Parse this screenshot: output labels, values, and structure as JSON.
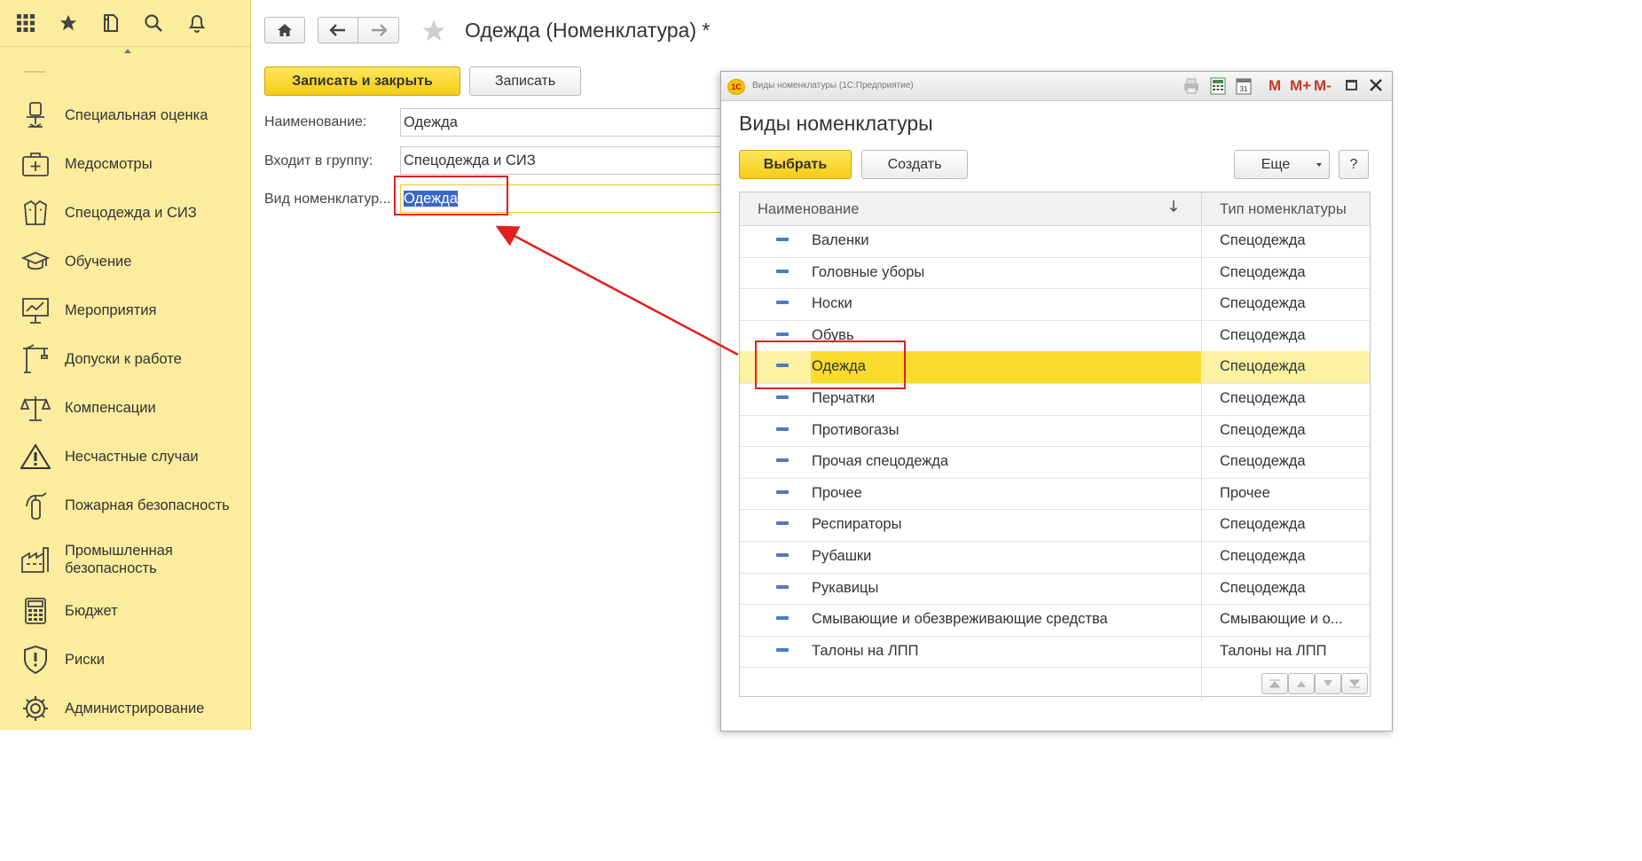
{
  "sidebar": {
    "items": [
      {
        "label": "Специальная оценка",
        "icon": "workplace-assessment-icon"
      },
      {
        "label": "Медосмотры",
        "icon": "medical-kit-icon"
      },
      {
        "label": "Спецодежда и СИЗ",
        "icon": "workwear-jacket-icon"
      },
      {
        "label": "Обучение",
        "icon": "graduation-cap-icon"
      },
      {
        "label": "Мероприятия",
        "icon": "presentation-board-icon"
      },
      {
        "label": "Допуски к работе",
        "icon": "crane-icon"
      },
      {
        "label": "Компенсации",
        "icon": "scales-icon"
      },
      {
        "label": "Несчастные случаи",
        "icon": "warning-triangle-icon"
      },
      {
        "label": "Пожарная безопасность",
        "icon": "fire-extinguisher-icon"
      },
      {
        "label": "Промышленная безопасность",
        "icon": "factory-icon"
      },
      {
        "label": "Бюджет",
        "icon": "calculator-icon"
      },
      {
        "label": "Риски",
        "icon": "risk-shield-icon"
      },
      {
        "label": "Администрирование",
        "icon": "gear-icon"
      }
    ]
  },
  "form": {
    "title": "Одежда (Номенклатура) *",
    "save_close_label": "Записать и закрыть",
    "save_label": "Записать",
    "name_label": "Наименование:",
    "name_value": "Одежда",
    "group_label": "Входит в группу:",
    "group_value": "Спецодежда и СИЗ",
    "kind_label": "Вид номенклатур...",
    "kind_value": "Одежда"
  },
  "dialog": {
    "window_title": "Виды номенклатуры  (1С:Предприятие)",
    "heading": "Виды номенклатуры",
    "select_label": "Выбрать",
    "create_label": "Создать",
    "more_label": "Еще",
    "help_label": "?",
    "title_buttons": [
      "M",
      "M+",
      "M-"
    ],
    "columns": {
      "name": "Наименование",
      "type": "Тип номенклатуры"
    },
    "rows": [
      {
        "name": "Валенки",
        "type": "Спецодежда"
      },
      {
        "name": "Головные уборы",
        "type": "Спецодежда"
      },
      {
        "name": "Носки",
        "type": "Спецодежда"
      },
      {
        "name": "Обувь",
        "type": "Спецодежда"
      },
      {
        "name": "Одежда",
        "type": "Спецодежда"
      },
      {
        "name": "Перчатки",
        "type": "Спецодежда"
      },
      {
        "name": "Противогазы",
        "type": "Спецодежда"
      },
      {
        "name": "Прочая спецодежда",
        "type": "Спецодежда"
      },
      {
        "name": "Прочее",
        "type": "Прочее"
      },
      {
        "name": "Респираторы",
        "type": "Спецодежда"
      },
      {
        "name": "Рубашки",
        "type": "Спецодежда"
      },
      {
        "name": "Рукавицы",
        "type": "Спецодежда"
      },
      {
        "name": "Смывающие и обезвреживающие средства",
        "type": "Смывающие и о..."
      },
      {
        "name": "Талоны на ЛПП",
        "type": "Талоны на ЛПП"
      }
    ],
    "selected_index": 4
  },
  "colors": {
    "sidebar_bg": "#fcec9d",
    "accent_yellow": "#f6cc17",
    "selection_blue": "#3a67c7",
    "annotation_red": "#e02020"
  }
}
